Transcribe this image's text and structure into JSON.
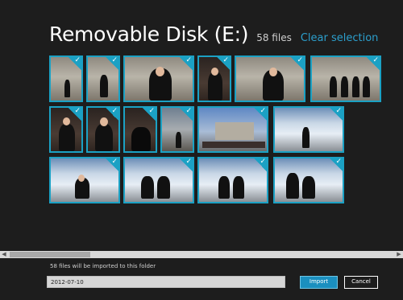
{
  "header": {
    "title": "Removable Disk (E:)",
    "file_count": "58 files",
    "clear_selection": "Clear selection"
  },
  "thumbnails": [
    {
      "style": "p-stone"
    },
    {
      "style": "p-stone"
    },
    {
      "style": "p-stone"
    },
    {
      "style": "p-dark"
    },
    {
      "style": "p-stone"
    },
    {
      "style": "p-stone"
    },
    {
      "style": "p-dark"
    },
    {
      "style": "p-dark"
    },
    {
      "style": "p-dark"
    },
    {
      "style": "p-city"
    },
    {
      "style": "p-sky"
    },
    {
      "style": "p-fountain"
    },
    {
      "style": "p-fountain"
    },
    {
      "style": "p-fountain"
    },
    {
      "style": "p-fountain"
    },
    {
      "style": "p-fountain"
    }
  ],
  "check_glyph": "✓",
  "scrollbar": {
    "left_arrow": "◀",
    "right_arrow": "▶"
  },
  "footer": {
    "info": "58 files will be imported to this folder",
    "folder_value": "2012-07-10",
    "import_label": "Import",
    "cancel_label": "Cancel"
  },
  "colors": {
    "accent": "#1ba1c4",
    "link": "#2c9fcd",
    "background": "#1d1d1d"
  }
}
